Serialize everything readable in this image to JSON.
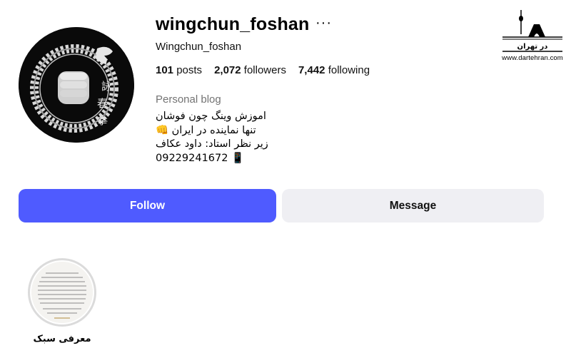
{
  "profile": {
    "username": "wingchun_foshan",
    "more_icon": "more-horizontal-icon",
    "full_name": "Wingchun_foshan",
    "stats": {
      "posts_count": "101",
      "posts_label": "posts",
      "followers_count": "2,072",
      "followers_label": "followers",
      "following_count": "7,442",
      "following_label": "following"
    },
    "category": "Personal blog",
    "bio": {
      "line1": "اموزش وینگ چون فوشان",
      "line2": "تنها نماینده در ایران 👊",
      "line3": "زیر نظر استاد: داود عکاف",
      "line4": "09229241672 📱"
    }
  },
  "actions": {
    "follow_label": "Follow",
    "message_label": "Message"
  },
  "highlights": [
    {
      "label": "معرفی سبک",
      "icon": "document-cover"
    }
  ],
  "watermark": {
    "logo_text": "در تهران",
    "url": "www.dartehran.com"
  },
  "colors": {
    "follow_button": "#4f5bff",
    "message_button": "#efeff3",
    "secondary_text": "#737373"
  }
}
